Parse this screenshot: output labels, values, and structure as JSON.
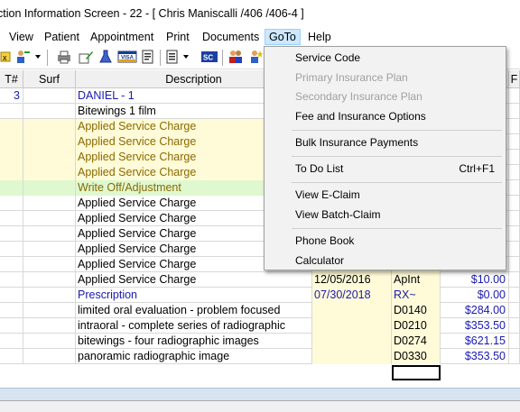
{
  "window": {
    "title": "ction Information Screen - 22 - [ Chris Maniscalli /406 /406-4 ]"
  },
  "menubar": {
    "items": [
      {
        "label": "View"
      },
      {
        "label": "Patient"
      },
      {
        "label": "Appointment"
      },
      {
        "label": "Print"
      },
      {
        "label": "Documents"
      },
      {
        "label": "GoTo"
      },
      {
        "label": "Help"
      }
    ]
  },
  "toolbar": {
    "icons": [
      "folder-icon",
      "person-plus-icon",
      "dropdown-caret",
      "printer-icon",
      "pencil-form-icon",
      "chemistry-flask-icon",
      "visa-card-icon",
      "document-list-icon",
      "form-list-icon",
      "sc-icon",
      "people-icon",
      "person-star-icon"
    ]
  },
  "grid": {
    "columns": [
      "T#",
      "Surf",
      "Description",
      "",
      "",
      "",
      "F"
    ],
    "rows": [
      {
        "tooth": "3",
        "surf": "",
        "description": "DANIEL - 1",
        "date": "",
        "code": "",
        "amount": "",
        "style": "blue"
      },
      {
        "tooth": "",
        "surf": "",
        "description": "Bitewings 1 film",
        "date": "",
        "code": "",
        "amount": "",
        "style": "plain"
      },
      {
        "tooth": "",
        "surf": "",
        "description": "Applied Service Charge",
        "date": "",
        "code": "",
        "amount": "",
        "style": "yellow"
      },
      {
        "tooth": "",
        "surf": "",
        "description": "Applied Service Charge",
        "date": "",
        "code": "",
        "amount": "",
        "style": "yellow"
      },
      {
        "tooth": "",
        "surf": "",
        "description": "Applied Service Charge",
        "date": "",
        "code": "",
        "amount": "",
        "style": "yellow"
      },
      {
        "tooth": "",
        "surf": "",
        "description": "Applied Service Charge",
        "date": "",
        "code": "",
        "amount": "",
        "style": "yellow"
      },
      {
        "tooth": "",
        "surf": "",
        "description": "Write Off/Adjustment",
        "date": "",
        "code": "",
        "amount": "",
        "style": "green"
      },
      {
        "tooth": "",
        "surf": "",
        "description": "Applied Service Charge",
        "date": "",
        "code": "",
        "amount": "",
        "style": "plain"
      },
      {
        "tooth": "",
        "surf": "",
        "description": "Applied Service Charge",
        "date": "",
        "code": "",
        "amount": "",
        "style": "plain"
      },
      {
        "tooth": "",
        "surf": "",
        "description": "Applied Service Charge",
        "date": "",
        "code": "",
        "amount": "",
        "style": "plain"
      },
      {
        "tooth": "",
        "surf": "",
        "description": "Applied Service Charge",
        "date": "",
        "code": "",
        "amount": "",
        "style": "plain"
      },
      {
        "tooth": "",
        "surf": "",
        "description": "Applied Service Charge",
        "date": "",
        "code": "",
        "amount": "",
        "style": "plain"
      },
      {
        "tooth": "",
        "surf": "",
        "description": "Applied Service Charge",
        "date": "12/05/2016",
        "code": "ApInt",
        "amount": "$10.00",
        "style": "plain"
      },
      {
        "tooth": "",
        "surf": "",
        "description": "Prescription",
        "date": "07/30/2018",
        "code": "RX~",
        "amount": "$0.00",
        "style": "blue"
      },
      {
        "tooth": "",
        "surf": "",
        "description": "limited oral evaluation - problem focused",
        "date": "",
        "code": "D0140",
        "amount": "$284.00",
        "style": "plain"
      },
      {
        "tooth": "",
        "surf": "",
        "description": "intraoral - complete series of radiographic",
        "date": "",
        "code": "D0210",
        "amount": "$353.50",
        "style": "plain"
      },
      {
        "tooth": "",
        "surf": "",
        "description": "bitewings - four radiographic images",
        "date": "",
        "code": "D0274",
        "amount": "$621.15",
        "style": "plain"
      },
      {
        "tooth": "",
        "surf": "",
        "description": "panoramic radiographic image",
        "date": "",
        "code": "D0330",
        "amount": "$353.50",
        "style": "plain"
      }
    ]
  },
  "goto_menu": {
    "items": [
      {
        "label": "Service Code",
        "shortcut": "",
        "enabled": true
      },
      {
        "label": "Primary Insurance Plan",
        "shortcut": "",
        "enabled": false
      },
      {
        "label": "Secondary Insurance Plan",
        "shortcut": "",
        "enabled": false
      },
      {
        "label": "Fee and Insurance Options",
        "shortcut": "",
        "enabled": true
      },
      {
        "label": "Bulk Insurance Payments",
        "shortcut": "",
        "enabled": true
      },
      {
        "label": "To Do List",
        "shortcut": "Ctrl+F1",
        "enabled": true
      },
      {
        "label": "View E-Claim",
        "shortcut": "",
        "enabled": true
      },
      {
        "label": "View Batch-Claim",
        "shortcut": "",
        "enabled": true
      },
      {
        "label": "Phone Book",
        "shortcut": "",
        "enabled": true
      },
      {
        "label": "Calculator",
        "shortcut": "",
        "enabled": true
      }
    ]
  },
  "status": {
    "left": "",
    "middle": "",
    "right": ""
  },
  "colors": {
    "menu_highlight": "#cce8ff",
    "row_yellow": "#fffbd8",
    "row_green": "#dff8d0",
    "text_blue": "#1a1ab0",
    "text_olive": "#8a6a00"
  }
}
